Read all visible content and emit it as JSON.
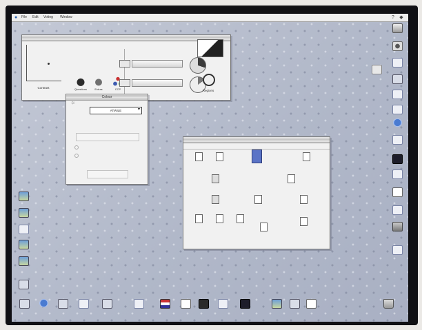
{
  "menubar": {
    "apple": "",
    "menus": [
      "File",
      "Edit",
      "Voting",
      "Window"
    ],
    "clock": "",
    "tray_icons": [
      "help-icon",
      "application-switcher-icon"
    ]
  },
  "control_window": {
    "title": "",
    "stamp_text": "",
    "graph_label": "Contrast",
    "items": [
      {
        "label": "Questions",
        "icon": "teapot-icon"
      },
      {
        "label": "Extras",
        "icon": "cup-icon"
      },
      {
        "label": "CCP",
        "icon": "circles-icon"
      }
    ],
    "rows": [
      "",
      ""
    ],
    "speaker_label": "Regions"
  },
  "chooser_window": {
    "title": "Colour",
    "selected": "ATWILE",
    "options_disabled": [
      "",
      "",
      ""
    ],
    "button_disabled": ""
  },
  "finder_window": {
    "title": "",
    "header_left": "",
    "header_right": "",
    "items": [
      {
        "label": "",
        "kind": "doc"
      },
      {
        "label": "",
        "kind": "doc"
      },
      {
        "label": "",
        "kind": "selected"
      },
      {
        "label": "",
        "kind": "doc"
      },
      {
        "label": "",
        "kind": "app"
      },
      {
        "label": "",
        "kind": "doc"
      },
      {
        "label": "",
        "kind": "app"
      },
      {
        "label": "",
        "kind": "doc"
      },
      {
        "label": "",
        "kind": "doc"
      },
      {
        "label": "",
        "kind": "doc"
      },
      {
        "label": "",
        "kind": "doc"
      },
      {
        "label": "",
        "kind": "doc"
      },
      {
        "label": "",
        "kind": "doc"
      },
      {
        "label": "",
        "kind": "doc"
      }
    ]
  },
  "right_icons": [
    {
      "label": "",
      "icon": "hard-disk-icon"
    },
    {
      "label": "",
      "icon": "tools-icon"
    },
    {
      "label": "",
      "icon": "folder-icon"
    },
    {
      "label": "",
      "icon": "application-icon"
    },
    {
      "label": "",
      "icon": "folder-icon"
    },
    {
      "label": "",
      "icon": "folder-icon"
    },
    {
      "label": "",
      "icon": "globe-icon"
    },
    {
      "label": "",
      "icon": "folder-icon"
    },
    {
      "label": "",
      "icon": "monitor-icon"
    },
    {
      "label": "",
      "icon": "folder-icon"
    },
    {
      "label": "",
      "icon": "document-icon"
    },
    {
      "label": "",
      "icon": "folder-icon"
    },
    {
      "label": "",
      "icon": "drive-icon"
    },
    {
      "label": "",
      "icon": "folder-icon"
    }
  ],
  "folder_desktop": {
    "label": "",
    "icon": "folder-icon"
  },
  "left_icons": [
    {
      "label": "",
      "icon": "picture-icon"
    },
    {
      "label": "",
      "icon": "picture-icon"
    },
    {
      "label": "",
      "icon": "folder-icon"
    },
    {
      "label": "",
      "icon": "picture-icon"
    },
    {
      "label": "",
      "icon": "picture-icon"
    },
    {
      "label": "",
      "icon": "application-icon"
    }
  ],
  "bottom_icons": [
    {
      "label": "",
      "icon": "application-icon"
    },
    {
      "label": "",
      "icon": "globe-icon"
    },
    {
      "label": "",
      "icon": "application-icon"
    },
    {
      "label": "",
      "icon": "folder-icon"
    },
    {
      "label": "",
      "icon": "application-icon"
    },
    {
      "label": "",
      "icon": "folder-icon"
    },
    {
      "label": "",
      "icon": "flag-icon"
    },
    {
      "label": "",
      "icon": "document-icon"
    },
    {
      "label": "",
      "icon": "book-icon"
    },
    {
      "label": "",
      "icon": "folder-icon"
    },
    {
      "label": "",
      "icon": "monitor-icon"
    },
    {
      "label": "",
      "icon": "picture-icon"
    },
    {
      "label": "",
      "icon": "application-icon"
    },
    {
      "label": "",
      "icon": "document-icon"
    },
    {
      "label": "",
      "icon": "trash-icon"
    }
  ],
  "colors": {
    "desktop": "#b5bccb",
    "window": "#f1f1f1",
    "accent": "#2a62b0",
    "stamp": "#c6262a"
  }
}
